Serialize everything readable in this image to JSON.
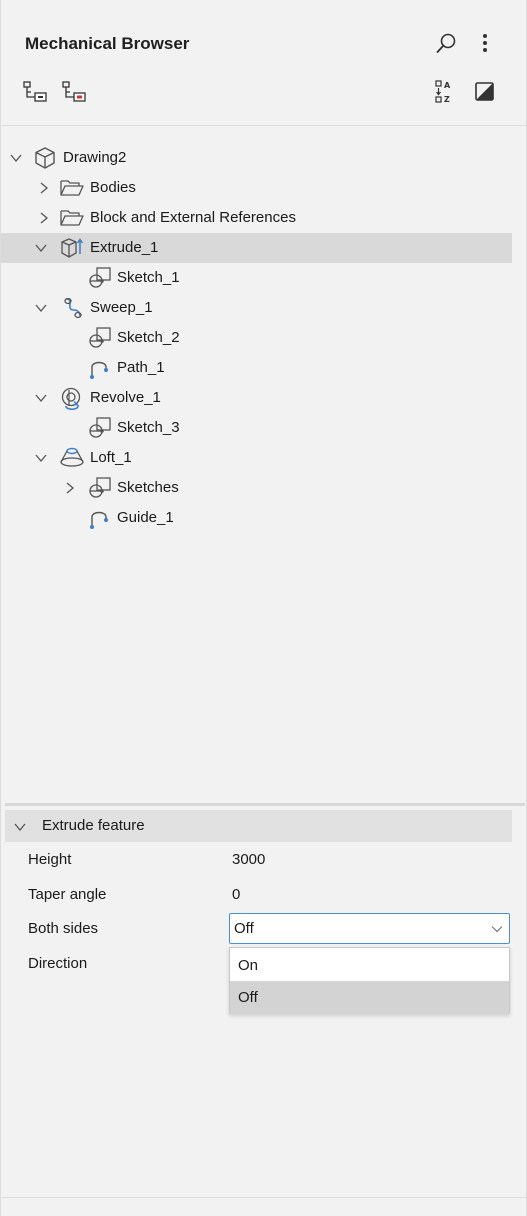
{
  "header": {
    "title": "Mechanical Browser",
    "icons": [
      "search-icon",
      "more-options-icon",
      "tree-expand-icon",
      "tree-collapse-icon",
      "sort-az-icon",
      "display-mode-icon"
    ]
  },
  "tree": {
    "root": "Drawing2",
    "bodies": "Bodies",
    "block_refs": "Block and External References",
    "extrude": "Extrude_1",
    "sketch1": "Sketch_1",
    "sweep": "Sweep_1",
    "sketch2": "Sketch_2",
    "path1": "Path_1",
    "revolve": "Revolve_1",
    "sketch3": "Sketch_3",
    "loft": "Loft_1",
    "sketches": "Sketches",
    "guide1": "Guide_1"
  },
  "properties": {
    "section": "Extrude feature",
    "height_label": "Height",
    "height_value": "3000",
    "taper_label": "Taper angle",
    "taper_value": "0",
    "both_sides_label": "Both sides",
    "both_sides_value": "Off",
    "direction_label": "Direction",
    "options": [
      "On",
      "Off"
    ]
  },
  "colors": {
    "accent": "#3d7fc8",
    "selected_row": "#d9d9d9",
    "red_marker": "#d9322b"
  }
}
